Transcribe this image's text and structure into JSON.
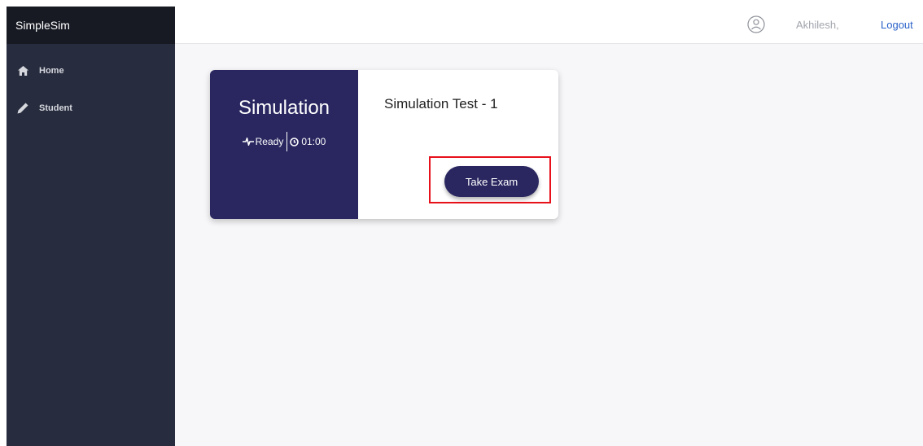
{
  "sidebar": {
    "brand": "SimpleSim",
    "items": [
      {
        "label": "Home",
        "icon": "home-icon"
      },
      {
        "label": "Student",
        "icon": "pencil-icon"
      }
    ]
  },
  "header": {
    "avatar_icon": "user-avatar-icon",
    "user_name": "Akhilesh,",
    "logout_label": "Logout"
  },
  "card": {
    "category": "Simulation",
    "status": "Ready",
    "status_icon": "pulse-icon",
    "duration": "01:00",
    "duration_icon": "clock-icon",
    "title": "Simulation Test - 1",
    "action_label": "Take Exam"
  },
  "colors": {
    "sidebar_bg": "#272c3e",
    "brand_bg": "#171a23",
    "card_accent": "#2a2760",
    "highlight": "#e8101b",
    "link": "#2a62c9"
  }
}
